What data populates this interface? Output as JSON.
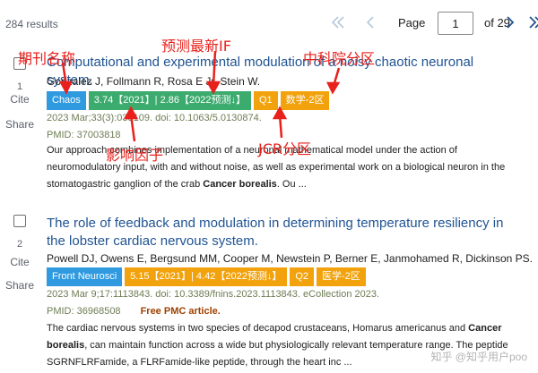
{
  "results_count": "284 results",
  "pagination": {
    "page_label": "Page",
    "current_page": "1",
    "of_text": "of 29",
    "icons": [
      "first-page-icon",
      "prev-page-icon",
      "next-page-icon",
      "last-page-icon"
    ]
  },
  "side_actions": {
    "cite": "Cite",
    "share": "Share"
  },
  "annotations": {
    "journal_name": "期刊名称",
    "predicted_if": "预测最新IF",
    "cas_partition": "中科院分区",
    "impact_factor": "影响因子",
    "jcr_partition": "JCR分区"
  },
  "results": [
    {
      "rank": "1",
      "title": "Computational and experimental modulation of a noisy chaotic neuronal system.",
      "authors": "Gonzalez J, Follmann R, Rosa E Jr, Stein W.",
      "badges": {
        "journal": "Chaos",
        "impact": "3.74【2021】| 2.86【2022预测↓】",
        "jcr": "Q1",
        "cas": "数学-2区"
      },
      "citation": "2023 Mar;33(3):033109. doi: 10.1063/5.0130874.",
      "pmid": "PMID: 37003818",
      "free_pmc": "",
      "snippet_parts": [
        "Our approach combines implementation of a neuronal mathematical model under the action of neuromodulatory input, with and without noise, as well as experimental work on a biological neuron in the stomatogastric ganglion of the crab ",
        "Cancer borealis",
        ". Ou ..."
      ]
    },
    {
      "rank": "2",
      "title": "The role of feedback and modulation in determining temperature resiliency in the lobster cardiac nervous system.",
      "authors": "Powell DJ, Owens E, Bergsund MM, Cooper M, Newstein P, Berner E, Janmohamed R, Dickinson PS.",
      "badges": {
        "journal": "Front Neurosci",
        "impact": "5.15【2021】| 4.42【2022预测↓】",
        "jcr": "Q2",
        "cas": "医学-2区"
      },
      "citation": "2023 Mar 9;17:1113843. doi: 10.3389/fnins.2023.1113843. eCollection 2023.",
      "pmid": "PMID: 36968508",
      "free_pmc": "Free PMC article.",
      "snippet_parts": [
        "The cardiac nervous systems in two species of decapod crustaceans, Homarus americanus and ",
        "Cancer borealis",
        ", can maintain function across a wide but physiologically relevant temperature range. The peptide SGRNFLRFamide, a FLRFamide-like peptide, through the heart inc ..."
      ]
    }
  ],
  "watermark": "知乎 @知乎用户poo",
  "colors": {
    "title_link": "#205493",
    "meta_text": "#6e7d54",
    "annotation_red": "#e8211c",
    "badge_journal": "#2f9ae0",
    "badge_impact": "#3cab6e",
    "badge_jcr": "#f2a20c",
    "badge_cas": "#f2a20c"
  }
}
